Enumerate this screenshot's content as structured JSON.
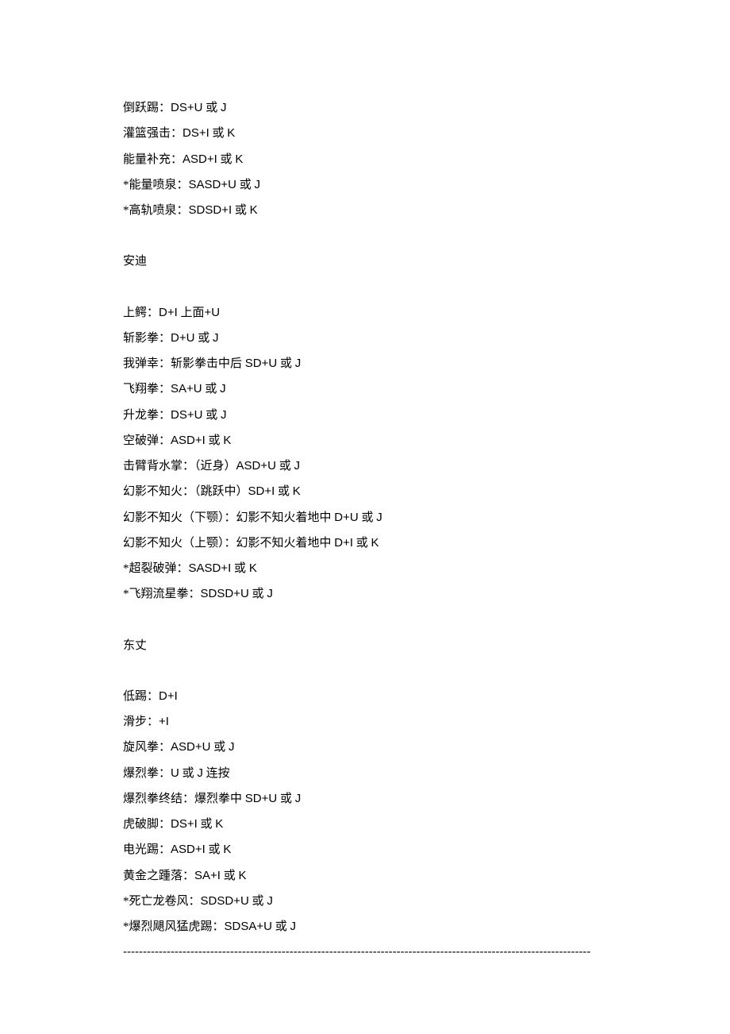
{
  "sections": [
    {
      "title": null,
      "moves": [
        {
          "name": "倒跃踢：",
          "cmd": "DS+U",
          "suffix": " 或 ",
          "alt": "J"
        },
        {
          "name": "灌篮强击：",
          "cmd": "DS+I",
          "suffix": " 或 ",
          "alt": "K"
        },
        {
          "name": "能量补充：",
          "cmd": "ASD+I",
          "suffix": " 或 ",
          "alt": "K"
        },
        {
          "name": "*能量喷泉：",
          "cmd": "SASD+U",
          "suffix": " 或 ",
          "alt": "J"
        },
        {
          "name": "*高轨喷泉：",
          "cmd": "SDSD+I",
          "suffix": " 或 ",
          "alt": "K"
        }
      ]
    },
    {
      "title": "安迪",
      "moves": [
        {
          "name": "上鳄：",
          "cmd": "D+I",
          "suffix": " 上面",
          "alt": "+U"
        },
        {
          "name": "斩影拳：",
          "cmd": "D+U",
          "suffix": " 或 ",
          "alt": "J"
        },
        {
          "name": "我弹幸：斩影拳击中后 ",
          "cmd": "SD+U",
          "suffix": " 或 ",
          "alt": "J"
        },
        {
          "name": "飞翔拳：",
          "cmd": "SA+U",
          "suffix": " 或 ",
          "alt": "J"
        },
        {
          "name": "升龙拳：",
          "cmd": "DS+U",
          "suffix": " 或 ",
          "alt": "J"
        },
        {
          "name": "空破弹：",
          "cmd": "ASD+I",
          "suffix": " 或 ",
          "alt": "K"
        },
        {
          "name": "击臂背水掌：（近身）",
          "cmd": "ASD+U",
          "suffix": " 或 ",
          "alt": "J"
        },
        {
          "name": "幻影不知火：（跳跃中）",
          "cmd": "SD+I",
          "suffix": " 或 ",
          "alt": "K"
        },
        {
          "name": "幻影不知火（下颚）：幻影不知火着地中 ",
          "cmd": "D+U",
          "suffix": " 或 ",
          "alt": "J"
        },
        {
          "name": "幻影不知火（上颚）：幻影不知火着地中 ",
          "cmd": "D+I",
          "suffix": " 或 ",
          "alt": "K"
        },
        {
          "name": "*超裂破弹：",
          "cmd": "SASD+I",
          "suffix": " 或 ",
          "alt": "K"
        },
        {
          "name": "*飞翔流星拳：",
          "cmd": "SDSD+U",
          "suffix": " 或 ",
          "alt": "J"
        }
      ]
    },
    {
      "title": "东丈",
      "moves": [
        {
          "name": "低踢：",
          "cmd": "D+I",
          "suffix": "",
          "alt": ""
        },
        {
          "name": "滑步：",
          "cmd": "+I",
          "suffix": "",
          "alt": ""
        },
        {
          "name": "旋风拳：",
          "cmd": "ASD+U",
          "suffix": " 或 ",
          "alt": "J"
        },
        {
          "name": "爆烈拳：",
          "cmd": "U",
          "suffix": " 或 ",
          "alt": "J",
          "tail": " 连按"
        },
        {
          "name": "爆烈拳终结：爆烈拳中 ",
          "cmd": "SD+U",
          "suffix": " 或 ",
          "alt": "J"
        },
        {
          "name": "虎破脚：",
          "cmd": "DS+I",
          "suffix": " 或 ",
          "alt": "K"
        },
        {
          "name": "电光踢：",
          "cmd": "ASD+I",
          "suffix": " 或 ",
          "alt": "K"
        },
        {
          "name": "黄金之踵落：",
          "cmd": "SA+I",
          "suffix": " 或 ",
          "alt": "K"
        },
        {
          "name": "*死亡龙卷风：",
          "cmd": "SDSD+U",
          "suffix": " 或 ",
          "alt": "J"
        },
        {
          "name": "*爆烈飓风猛虎踢：",
          "cmd": "SDSA+U",
          "suffix": " 或 ",
          "alt": "J"
        }
      ]
    }
  ],
  "divider": "----------------------------------------------------------------------------------------------------------------------"
}
